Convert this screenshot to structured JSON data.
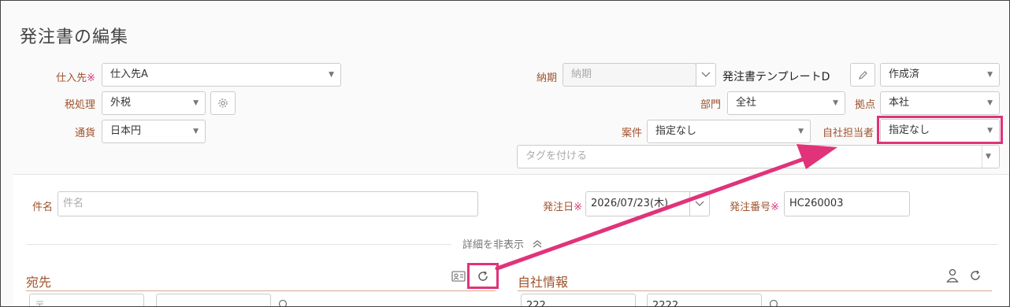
{
  "page": {
    "title": "発注書の編集"
  },
  "header": {
    "supplier": {
      "label": "仕入先",
      "req": "※",
      "value": "仕入先A"
    },
    "tax": {
      "label": "税処理",
      "value": "外税"
    },
    "currency": {
      "label": "通貨",
      "value": "日本円"
    },
    "delivery": {
      "label": "納期",
      "placeholder": "納期"
    },
    "template": {
      "value": "発注書テンプレートD"
    },
    "status": {
      "value": "作成済"
    },
    "department": {
      "label": "部門",
      "value": "全社"
    },
    "base": {
      "label": "拠点",
      "value": "本社"
    },
    "project": {
      "label": "案件",
      "value": "指定なし"
    },
    "owner": {
      "label": "自社担当者",
      "value": "指定なし"
    },
    "tags": {
      "placeholder": "タグを付ける"
    }
  },
  "detail": {
    "subject": {
      "label": "件名",
      "placeholder": "件名"
    },
    "order_date": {
      "label": "発注日",
      "req": "※",
      "value": "2026/07/23(木)"
    },
    "order_number": {
      "label": "発注番号",
      "req": "※",
      "value": "HC260003"
    },
    "toggle_label": "詳細を非表示",
    "recipient": {
      "title": "宛先",
      "field1_partial": "〒",
      "field2_partial": ""
    },
    "company": {
      "title": "自社情報",
      "field1_partial": "222",
      "field2_partial": "2222"
    }
  },
  "annotation": {
    "color": "#e0337a"
  }
}
